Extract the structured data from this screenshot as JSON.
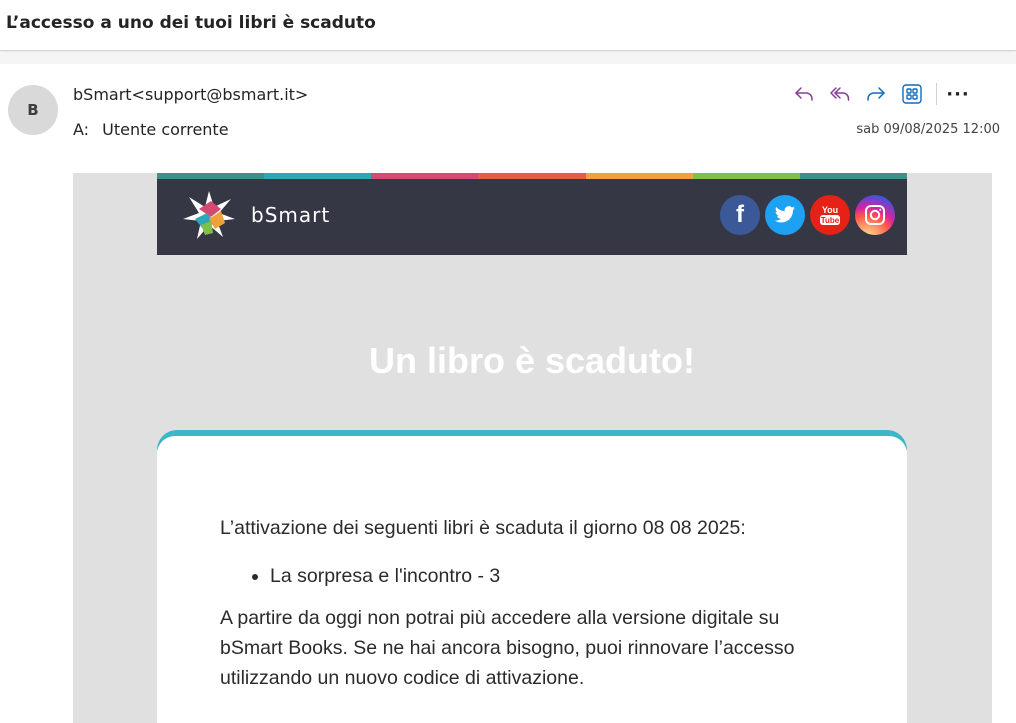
{
  "subject": "L’accesso a uno dei tuoi libri è scaduto",
  "sender": {
    "initial": "B",
    "display": "bSmart<support@bsmart.it>"
  },
  "recipient": {
    "label": "A:",
    "name": "Utente corrente"
  },
  "date": "sab 09/08/2025 12:00",
  "actions": {
    "reply_icon": "reply-icon",
    "reply_all_icon": "reply-all-icon",
    "forward_icon": "forward-icon",
    "apps_icon": "apps-icon",
    "more_label": "···"
  },
  "colors": {
    "accent_purple": "#8a3a9b",
    "accent_blue": "#0f6cbd",
    "header_bg": "#363744",
    "mail_bg": "#e0e0e0",
    "color_bar": [
      "#3f8f8a",
      "#2ea7b8",
      "#d44a72",
      "#e35d4a",
      "#f0a13a",
      "#7fbf4a",
      "#3f8f8a"
    ]
  },
  "email": {
    "brand": "bSmart",
    "socials": [
      {
        "name": "facebook-icon",
        "glyph": "f",
        "color": "#3b5998"
      },
      {
        "name": "twitter-icon",
        "glyph": "",
        "color": "#1da1f2"
      },
      {
        "name": "youtube-icon",
        "glyph": "You\nTube",
        "color": "#e62117"
      },
      {
        "name": "instagram-icon",
        "glyph": "",
        "color": "#c13584"
      }
    ],
    "title": "Un libro è scaduto!",
    "intro": "L’attivazione dei seguenti libri è scaduta il giorno 08 08 2025:",
    "books": [
      "La sorpresa e l'incontro - 3"
    ],
    "body": "A partire da oggi non potrai più accedere alla versione digitale su bSmart Books. Se ne hai ancora bisogno, puoi rinnovare l’accesso utilizzando un nuovo codice di attivazione."
  }
}
